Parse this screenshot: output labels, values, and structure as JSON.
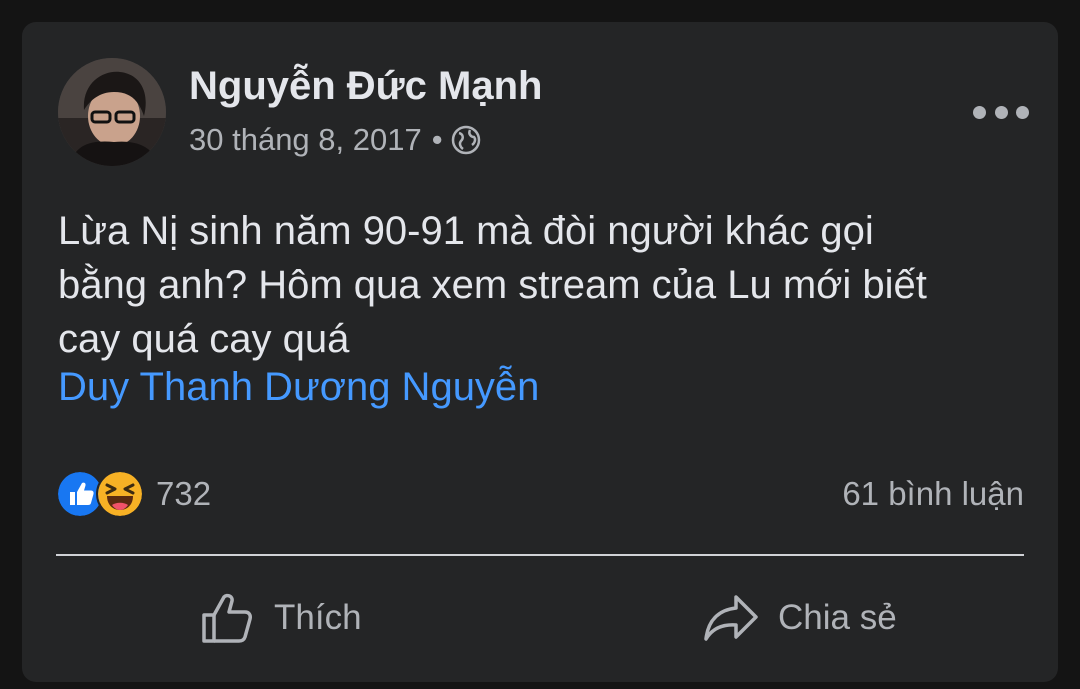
{
  "post": {
    "author": "Nguyễn Đức Mạnh",
    "date": "30 tháng 8, 2017",
    "separator": "•",
    "audience_icon": "globe-icon",
    "text": "Lừa Nị sinh năm 90-91 mà đòi người khác gọi\nbằng anh? Hôm qua xem stream của Lu mới biết\ncay quá cay quá",
    "mention": "Duy Thanh Dương Nguyễn"
  },
  "reactions": {
    "icons": [
      "like-reaction-icon",
      "haha-reaction-icon"
    ],
    "count": "732",
    "comments": "61 bình luận"
  },
  "actions": {
    "like_label": "Thích",
    "share_label": "Chia sẻ"
  },
  "colors": {
    "background": "#141414",
    "card": "#242526",
    "text": "#e4e6eb",
    "secondary_text": "#b0b3b8",
    "link": "#4599ff",
    "like_blue": "#1877f2",
    "haha_yellow": "#f7b125"
  }
}
